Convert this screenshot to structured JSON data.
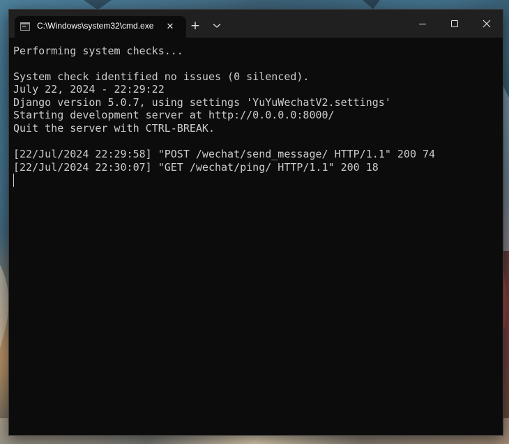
{
  "window": {
    "tab_title": "C:\\Windows\\system32\\cmd.exe",
    "tab_close_glyph": "✕",
    "new_tab_glyph": "+",
    "icons": {
      "tab_icon": "cmd-icon",
      "dropdown": "chevron-down-icon",
      "minimize": "minimize-icon",
      "maximize": "maximize-icon",
      "close": "close-icon"
    }
  },
  "console": {
    "lines": [
      "Performing system checks...",
      "System check identified no issues (0 silenced).",
      "July 22, 2024 - 22:29:22",
      "Django version 5.0.7, using settings 'YuYuWechatV2.settings'",
      "Starting development server at http://0.0.0.0:8000/",
      "Quit the server with CTRL-BREAK.",
      "[22/Jul/2024 22:29:58] \"POST /wechat/send_message/ HTTP/1.1\" 200 74",
      "[22/Jul/2024 22:30:07] \"GET /wechat/ping/ HTTP/1.1\" 200 18"
    ]
  },
  "colors": {
    "console_background": "#0c0c0c",
    "console_text": "#cccccc",
    "titlebar": "#202020"
  }
}
